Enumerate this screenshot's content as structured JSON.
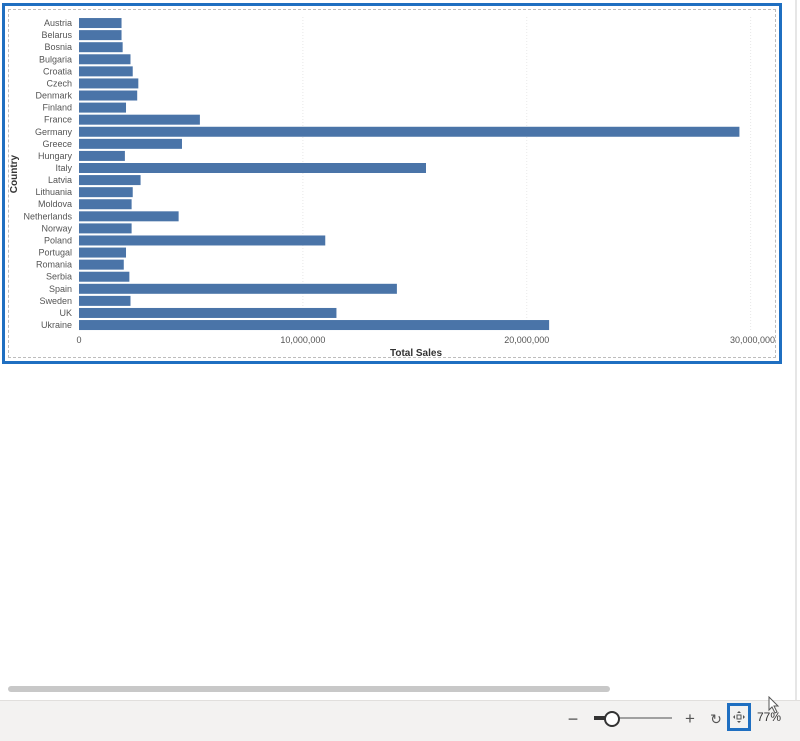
{
  "chart_data": {
    "type": "bar",
    "orientation": "horizontal",
    "categories": [
      "Austria",
      "Belarus",
      "Bosnia",
      "Bulgaria",
      "Croatia",
      "Czech",
      "Denmark",
      "Finland",
      "France",
      "Germany",
      "Greece",
      "Hungary",
      "Italy",
      "Latvia",
      "Lithuania",
      "Moldova",
      "Netherlands",
      "Norway",
      "Poland",
      "Portugal",
      "Romania",
      "Serbia",
      "Spain",
      "Sweden",
      "UK",
      "Ukraine"
    ],
    "values": [
      1900000,
      1900000,
      1950000,
      2300000,
      2400000,
      2650000,
      2600000,
      2100000,
      5400000,
      29500000,
      4600000,
      2050000,
      15500000,
      2750000,
      2400000,
      2350000,
      4450000,
      2350000,
      11000000,
      2100000,
      2000000,
      2250000,
      14200000,
      2300000,
      11500000,
      21000000
    ],
    "xlabel": "Total Sales",
    "ylabel": "Country",
    "xlim": [
      0,
      31000000
    ],
    "xticks": [
      0,
      10000000,
      20000000,
      30000000
    ],
    "xtick_labels": [
      "0",
      "10,000,000",
      "20,000,000",
      "30,000,000"
    ],
    "grid": true,
    "bar_color": "#4a74a8"
  },
  "statusbar": {
    "zoom_minus": "−",
    "zoom_plus": "+",
    "zoom_percent": "77%",
    "zoom_level": 0.77,
    "accent_color": "#1f6fc1"
  }
}
